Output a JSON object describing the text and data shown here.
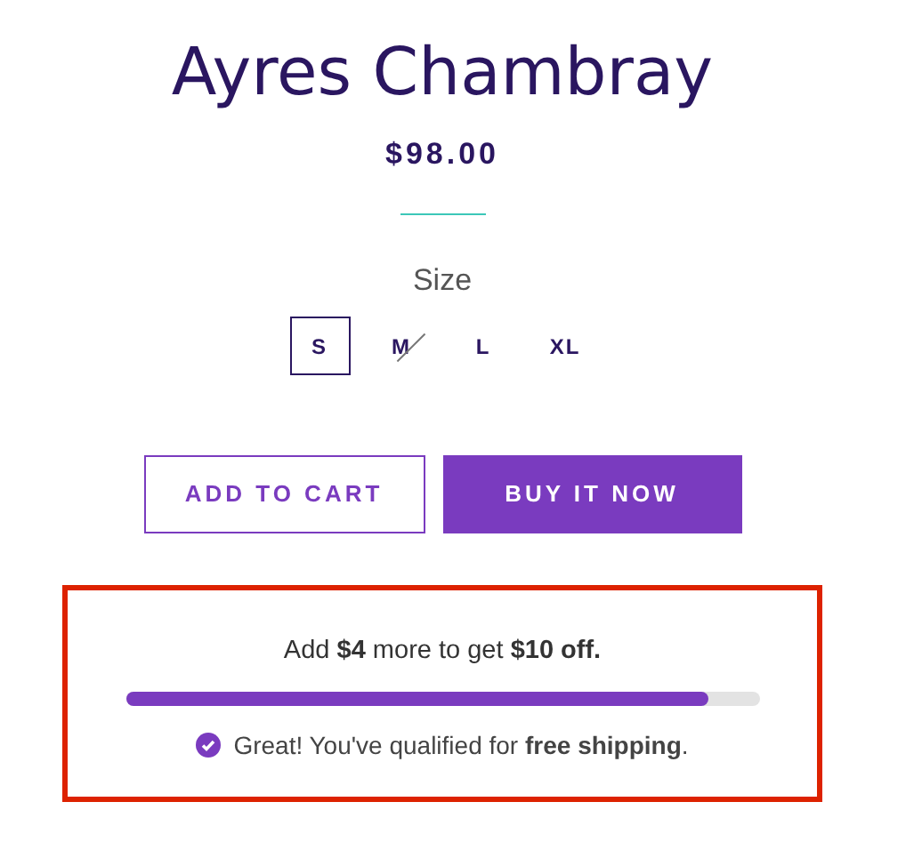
{
  "product": {
    "title": "Ayres Chambray",
    "price": "$98.00"
  },
  "size": {
    "label": "Size",
    "options": [
      {
        "label": "S",
        "selected": true,
        "available": true
      },
      {
        "label": "M",
        "selected": false,
        "available": false
      },
      {
        "label": "L",
        "selected": false,
        "available": true
      },
      {
        "label": "XL",
        "selected": false,
        "available": true
      }
    ]
  },
  "buttons": [
    {
      "label": "ADD TO CART",
      "kind": "outline"
    },
    {
      "label": "BUY IT NOW",
      "kind": "filled"
    }
  ],
  "promo": {
    "message": "Add **$4** more to get **$10 off.**",
    "level": 0.92,
    "note": "Great! You've qualified for **free shipping**."
  }
}
